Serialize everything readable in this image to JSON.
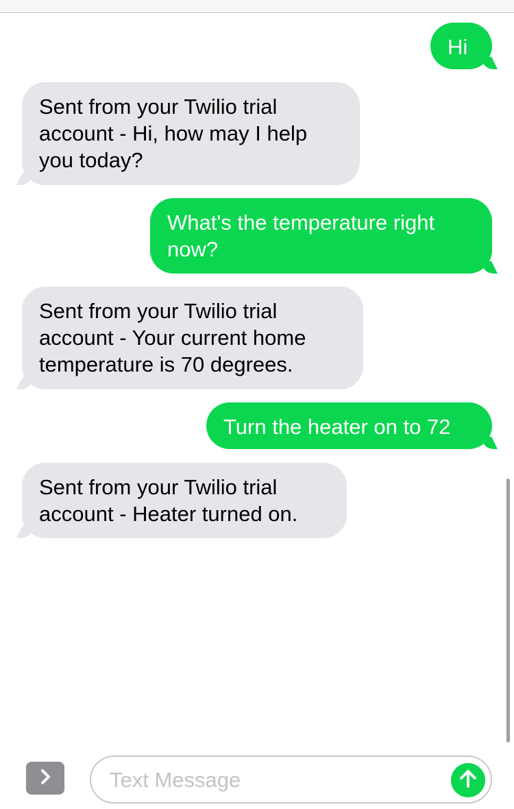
{
  "colors": {
    "sent_bubble": "#0cd64f",
    "received_bubble": "#e5e5ea",
    "send_button": "#0cd64f",
    "placeholder": "#c4c4c7"
  },
  "messages": [
    {
      "direction": "sent",
      "text": "Hi"
    },
    {
      "direction": "received",
      "text": "Sent from your Twilio trial\naccount - Hi, how may I help\nyou today?"
    },
    {
      "direction": "sent",
      "text": "What's the temperature right\nnow?"
    },
    {
      "direction": "received",
      "text": "Sent from your Twilio trial\naccount - Your current home\ntemperature is 70 degrees."
    },
    {
      "direction": "sent",
      "text": "Turn the heater on to 72"
    },
    {
      "direction": "received",
      "text": "Sent from your Twilio trial\naccount - Heater turned on."
    }
  ],
  "composer": {
    "placeholder": "Text Message",
    "expand_icon": "chevron-right-icon",
    "send_icon": "arrow-up-icon"
  }
}
